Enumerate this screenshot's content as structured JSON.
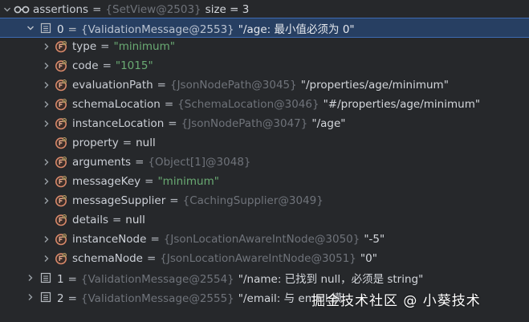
{
  "root": {
    "name": "assertions",
    "eq": "=",
    "ref": "{SetView@2503}",
    "suffix": "size = 3"
  },
  "entry0": {
    "name": "0",
    "eq": "=",
    "ref": "{ValidationMessage@2553}",
    "value": "\"/age: 最小值必须为 0\""
  },
  "fields": [
    {
      "name": "type",
      "eq": "=",
      "ref": "",
      "value": "\"minimum\"",
      "value_kind": "str",
      "expandable": true
    },
    {
      "name": "code",
      "eq": "=",
      "ref": "",
      "value": "\"1015\"",
      "value_kind": "str",
      "expandable": true
    },
    {
      "name": "evaluationPath",
      "eq": "=",
      "ref": "{JsonNodePath@3045}",
      "value": "\"/properties/age/minimum\"",
      "value_kind": "val",
      "expandable": true
    },
    {
      "name": "schemaLocation",
      "eq": "=",
      "ref": "{SchemaLocation@3046}",
      "value": "\"#/properties/age/minimum\"",
      "value_kind": "val",
      "expandable": true
    },
    {
      "name": "instanceLocation",
      "eq": "=",
      "ref": "{JsonNodePath@3047}",
      "value": "\"/age\"",
      "value_kind": "val",
      "expandable": true
    },
    {
      "name": "property",
      "eq": "=",
      "ref": "",
      "value": "null",
      "value_kind": "val",
      "expandable": false
    },
    {
      "name": "arguments",
      "eq": "=",
      "ref": "{Object[1]@3048}",
      "value": "",
      "value_kind": "val",
      "expandable": true
    },
    {
      "name": "messageKey",
      "eq": "=",
      "ref": "",
      "value": "\"minimum\"",
      "value_kind": "str",
      "expandable": true
    },
    {
      "name": "messageSupplier",
      "eq": "=",
      "ref": "{CachingSupplier@3049}",
      "value": "",
      "value_kind": "val",
      "expandable": true
    },
    {
      "name": "details",
      "eq": "=",
      "ref": "",
      "value": "null",
      "value_kind": "val",
      "expandable": false
    },
    {
      "name": "instanceNode",
      "eq": "=",
      "ref": "{JsonLocationAwareIntNode@3050}",
      "value": "\"-5\"",
      "value_kind": "val",
      "expandable": true
    },
    {
      "name": "schemaNode",
      "eq": "=",
      "ref": "{JsonLocationAwareIntNode@3051}",
      "value": "\"0\"",
      "value_kind": "val",
      "expandable": true
    }
  ],
  "entry1": {
    "name": "1",
    "eq": "=",
    "ref": "{ValidationMessage@2554}",
    "value": "\"/name: 已找到 null，必须是 string\""
  },
  "entry2": {
    "name": "2",
    "eq": "=",
    "ref": "{ValidationMessage@2555}",
    "value": "\"/email: 与 email 模"
  },
  "watermark": "掘金技术社区 @ 小葵技术",
  "icons": {
    "watch": "glasses-icon",
    "field": "field-icon",
    "list": "list-entry-icon"
  },
  "colors": {
    "background": "#26282b",
    "selection": "#273f62",
    "string": "#6aab73",
    "ref": "#6f737a",
    "field_icon_ring": "#d9896a"
  }
}
